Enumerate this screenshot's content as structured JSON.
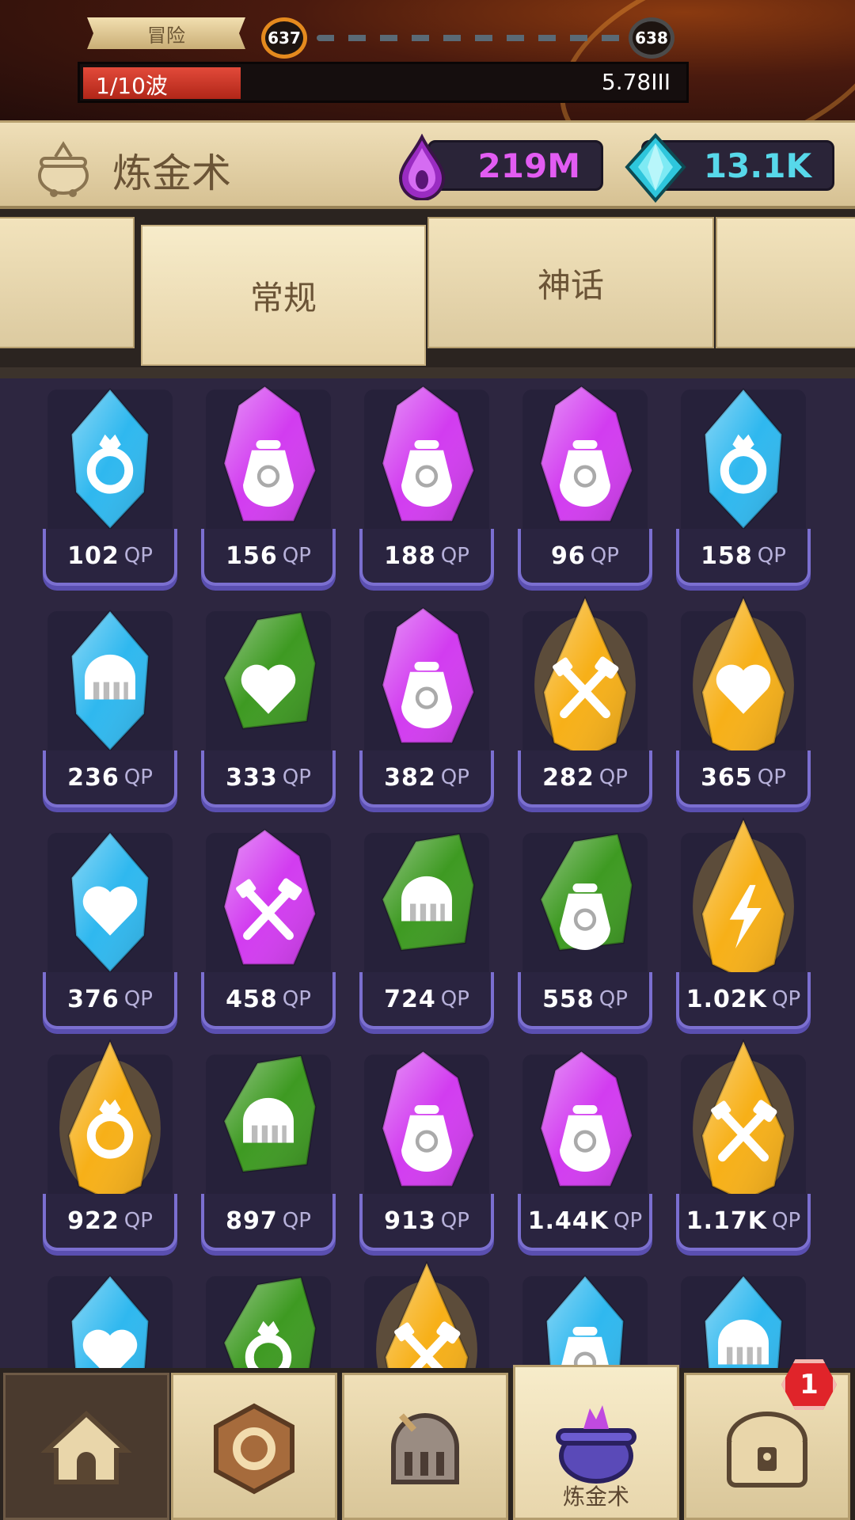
{
  "top": {
    "stage_label": "冒险",
    "level_current": "637",
    "level_next": "638",
    "wave_text": "1/10波",
    "wave_progress": 0.26,
    "wave_value": "5.78III"
  },
  "header": {
    "title": "炼金术",
    "elixir": "219M",
    "gems": "13.1K"
  },
  "tabs": [
    {
      "label": ""
    },
    {
      "label": "常规"
    },
    {
      "label": "神话"
    },
    {
      "label": ""
    }
  ],
  "qp_unit": "QP",
  "crystals": [
    {
      "value": "102",
      "color": "blue",
      "icon": "ring-icon"
    },
    {
      "value": "156",
      "color": "purple",
      "icon": "money-bag-icon"
    },
    {
      "value": "188",
      "color": "purple",
      "icon": "money-bag-icon"
    },
    {
      "value": "96",
      "color": "purple",
      "icon": "money-bag-icon"
    },
    {
      "value": "158",
      "color": "blue",
      "icon": "ring-icon"
    },
    {
      "value": "236",
      "color": "blue",
      "icon": "helmet-icon"
    },
    {
      "value": "333",
      "color": "green",
      "icon": "heart-icon"
    },
    {
      "value": "382",
      "color": "purple",
      "icon": "money-bag-icon"
    },
    {
      "value": "282",
      "color": "gold",
      "icon": "crossed-hammers-icon"
    },
    {
      "value": "365",
      "color": "gold",
      "icon": "heart-icon"
    },
    {
      "value": "376",
      "color": "blue",
      "icon": "heart-icon"
    },
    {
      "value": "458",
      "color": "purple",
      "icon": "crossed-hammers-icon"
    },
    {
      "value": "724",
      "color": "green",
      "icon": "helmet-icon"
    },
    {
      "value": "558",
      "color": "green",
      "icon": "money-bag-icon"
    },
    {
      "value": "1.02K",
      "color": "gold",
      "icon": "lightning-icon"
    },
    {
      "value": "922",
      "color": "gold",
      "icon": "ring-icon"
    },
    {
      "value": "897",
      "color": "green",
      "icon": "helmet-icon"
    },
    {
      "value": "913",
      "color": "purple",
      "icon": "money-bag-icon"
    },
    {
      "value": "1.44K",
      "color": "purple",
      "icon": "money-bag-icon"
    },
    {
      "value": "1.17K",
      "color": "gold",
      "icon": "crossed-hammers-icon"
    },
    {
      "value": "",
      "color": "blue",
      "icon": "heart-icon"
    },
    {
      "value": "",
      "color": "green",
      "icon": "ring-icon"
    },
    {
      "value": "",
      "color": "gold",
      "icon": "crossed-hammers-icon"
    },
    {
      "value": "",
      "color": "blue",
      "icon": "money-bag-icon"
    },
    {
      "value": "",
      "color": "blue",
      "icon": "helmet-icon"
    }
  ],
  "colors": {
    "blue": "#2fb8ef",
    "purple": "#d23cf0",
    "green": "#3e9a22",
    "gold": "#f7b018"
  },
  "nav": [
    {
      "name": "home",
      "icon": "house-icon",
      "label": ""
    },
    {
      "name": "heroes",
      "icon": "wood-badge-icon",
      "label": ""
    },
    {
      "name": "battle",
      "icon": "knight-helmet-icon",
      "label": ""
    },
    {
      "name": "alchemy",
      "icon": "cauldron-icon",
      "label": "炼金术"
    },
    {
      "name": "chest",
      "icon": "chest-icon",
      "label": "",
      "badge": "1"
    }
  ]
}
